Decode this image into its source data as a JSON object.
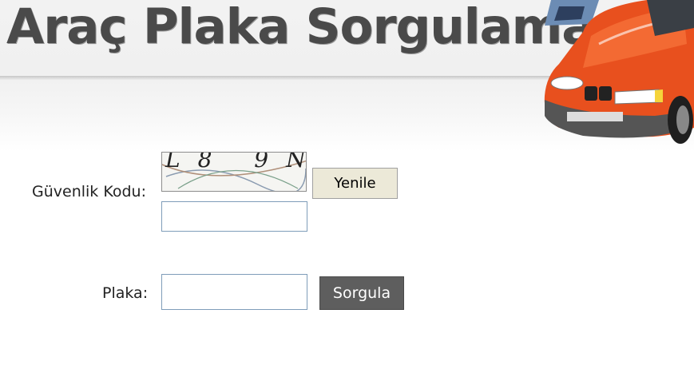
{
  "header": {
    "title": "Araç Plaka Sorgulama"
  },
  "form": {
    "security_label": "Güvenlik Kodu:",
    "captcha_text": "L8 9N",
    "captcha_value": "",
    "refresh_label": "Yenile",
    "plate_label": "Plaka:",
    "plate_value": "",
    "search_label": "Sorgula"
  },
  "colors": {
    "car_body": "#e8501e",
    "search_button": "#5e5e5e",
    "refresh_button": "#ece9d8"
  },
  "icons": {
    "header_image": "orange-car-image"
  }
}
